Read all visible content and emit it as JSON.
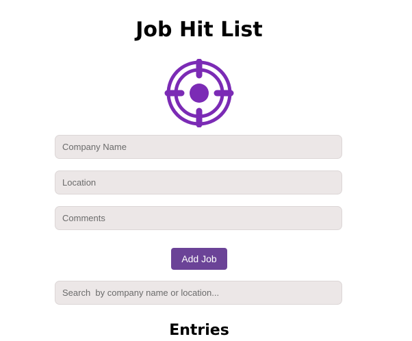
{
  "header": {
    "title": "Job Hit List"
  },
  "logo": {
    "icon": "crosshair-target-icon",
    "color": "#7b2bb5"
  },
  "form": {
    "company_placeholder": "Company Name",
    "location_placeholder": "Location",
    "comments_placeholder": "Comments",
    "company_value": "",
    "location_value": "",
    "comments_value": "",
    "add_button_label": "Add Job",
    "add_button_color": "#6b4397"
  },
  "search": {
    "placeholder": "Search  by company name or location...",
    "value": ""
  },
  "entries": {
    "title": "Entries"
  }
}
